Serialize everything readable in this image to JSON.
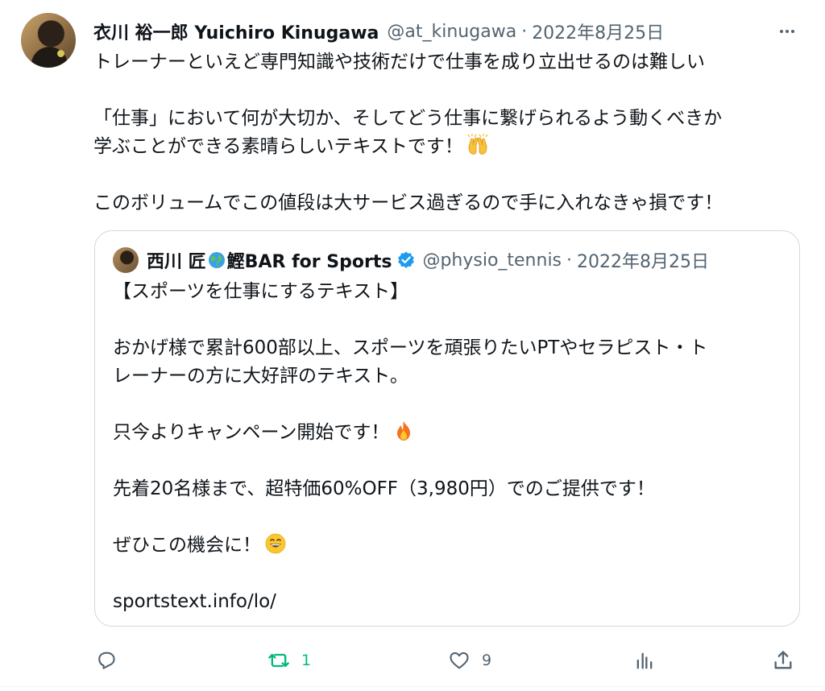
{
  "tweet": {
    "display_name": "衣川 裕一郎 Yuichiro Kinugawa",
    "handle": "@at_kinugawa",
    "separator": "·",
    "date": "2022年8月25日",
    "more_icon": "more-horizontal-icon",
    "lines": [
      "トレーナーといえど専門知識や技術だけで仕事を成り立出せるのは難しい",
      "",
      "「仕事」において何が大切か、そしてどう仕事に繋げられるよう動くべきか",
      "学ぶことができる素晴らしいテキストです！",
      "",
      "このボリュームでこの値段は大サービス過ぎるので手に入れなきゃ損です！"
    ],
    "line4_emoji": "raising-hands-emoji"
  },
  "quote": {
    "display_name_prefix": "西川 匠",
    "display_name_suffix": "鰹BAR for Sports",
    "globe_emoji": "globe-emoji",
    "verified_icon": "verified-badge-icon",
    "handle": "@physio_tennis",
    "separator": "·",
    "date": "2022年8月25日",
    "lines": [
      "【スポーツを仕事にするテキスト】",
      "",
      "おかげ様で累計600部以上、スポーツを頑張りたいPTやセラピスト・ト",
      "レーナーの方に大好評のテキスト。",
      "",
      "只今よりキャンペーン開始です！",
      "",
      "先着20名様まで、超特価60%OFF（3,980円）でのご提供です！",
      "",
      "ぜひこの機会に！",
      "",
      "sportstext.info/lo/"
    ],
    "fire_emoji": "fire-emoji",
    "smile_emoji": "grinning-face-emoji"
  },
  "actions": {
    "reply_icon": "reply-icon",
    "retweet_icon": "retweet-icon",
    "retweet_count": "1",
    "like_icon": "heart-icon",
    "like_count": "9",
    "views_icon": "analytics-icon",
    "share_icon": "share-icon"
  },
  "colors": {
    "text": "#0f1419",
    "secondary": "#536471",
    "border": "#cfd9de",
    "retweet_green": "#00ba7c",
    "verified_blue": "#1d9bf0"
  }
}
